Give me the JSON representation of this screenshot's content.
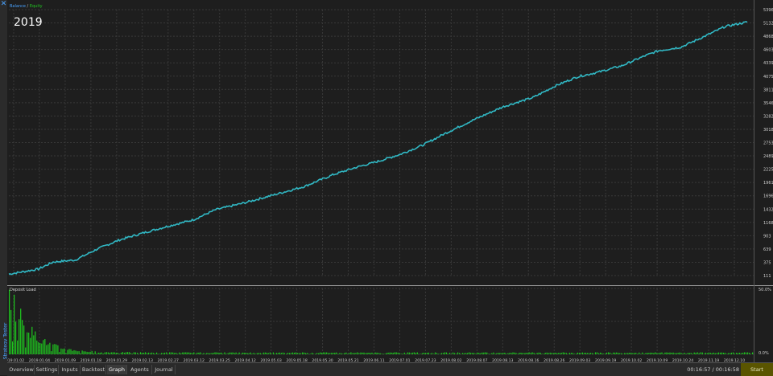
{
  "window": {
    "side_title": "Strategy Tester",
    "close_glyph": "✕"
  },
  "overlay_title": "2019",
  "main_legend": {
    "balance": "Balance",
    "sep": " / ",
    "equity": "Equity"
  },
  "sub_legend": "Deposit Load",
  "colors": {
    "background": "#1e1e1e",
    "grid": "#3a3a3a",
    "equity_line": "#31b8c4",
    "bars": "#1ec81e",
    "accent": "#4aa3ff"
  },
  "chart_data": [
    {
      "type": "line",
      "title": "",
      "legend": [
        "Balance",
        "Equity"
      ],
      "ylim": [
        111,
        5396
      ],
      "y_ticks": [
        "5396",
        "5132",
        "4868",
        "4603",
        "4339",
        "4075",
        "3811",
        "3546",
        "3282",
        "3018",
        "2753",
        "2489",
        "2225",
        "1961",
        "1696",
        "1432",
        "1168",
        "903",
        "639",
        "375",
        "111"
      ],
      "x_ticks": [
        "2019.01.02",
        "2019.01.04",
        "2019.01.09",
        "2019.01.18",
        "2019.01.29",
        "2019.02.13",
        "2019.02.27",
        "2019.03.12",
        "2019.03.25",
        "2019.04.12",
        "2019.05.03",
        "2019.05.18",
        "2019.05.30",
        "2019.05.21",
        "2019.06.11",
        "2019.07.01",
        "2019.07.23",
        "2019.08.02",
        "2019.08.07",
        "2019.08.13",
        "2019.08.16",
        "2019.08.26",
        "2019.09.03",
        "2019.09.19",
        "2019.10.02",
        "2019.10.09",
        "2019.10.24",
        "2019.11.19",
        "2019.12.10"
      ],
      "series": [
        {
          "name": "Equity",
          "x": [
            0,
            0.04,
            0.06,
            0.09,
            0.12,
            0.15,
            0.18,
            0.21,
            0.25,
            0.28,
            0.32,
            0.36,
            0.4,
            0.44,
            0.47,
            0.5,
            0.53,
            0.56,
            0.59,
            0.63,
            0.67,
            0.71,
            0.74,
            0.77,
            0.8,
            0.83,
            0.86,
            0.88,
            0.91,
            0.94,
            0.97,
            1.0
          ],
          "values": [
            140,
            240,
            380,
            420,
            640,
            820,
            950,
            1070,
            1220,
            1420,
            1560,
            1720,
            1880,
            2120,
            2260,
            2380,
            2520,
            2700,
            2930,
            3210,
            3470,
            3650,
            3880,
            4060,
            4160,
            4280,
            4470,
            4580,
            4650,
            4850,
            5060,
            5150
          ]
        }
      ]
    },
    {
      "type": "bar",
      "title": "Deposit Load",
      "ylim": [
        0,
        50
      ],
      "y_ticks": [
        "50.0%",
        "0.0%"
      ],
      "series": [
        {
          "name": "Deposit Load",
          "decay": {
            "start": 48,
            "floor": 1.2,
            "rate": 0.08
          }
        }
      ]
    }
  ],
  "tabs": [
    "Overview",
    "Settings",
    "Inputs",
    "Backtest",
    "Graph",
    "Agents",
    "Journal"
  ],
  "active_tab": "Graph",
  "status": {
    "time": "00:16:57 / 00:16:58",
    "start_label": "Start"
  }
}
